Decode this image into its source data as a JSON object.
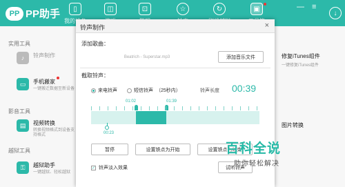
{
  "app": {
    "logo_text": "PP助手",
    "logo_badge": "P"
  },
  "nav": [
    {
      "label": "我的设备",
      "icon": "phone-icon"
    },
    {
      "label": "游戏",
      "icon": "bag-icon"
    },
    {
      "label": "影视",
      "icon": "gamepad-icon"
    },
    {
      "label": "铃声",
      "icon": "star-icon"
    },
    {
      "label": "刷机越狱",
      "icon": "refresh-icon"
    },
    {
      "label": "工具箱",
      "icon": "toolbox-icon"
    }
  ],
  "window_controls": {
    "minimize": "—",
    "menu": "≡"
  },
  "sidebar": {
    "sections": [
      "实用工具",
      "影音工具",
      "越狱工具"
    ],
    "tools": [
      {
        "name": "铃声制作",
        "desc": ""
      },
      {
        "name": "手机搬家",
        "desc": "一键搬迁数据至新设备"
      },
      {
        "name": "视频转换",
        "desc": "转换视频格式到设备支持格式"
      },
      {
        "name": "越狱助手",
        "desc": "一键越狱、轻松越狱"
      }
    ]
  },
  "right_panel": {
    "tools": [
      {
        "name": "修复iTunes组件",
        "desc": "一键修复iTunes组件"
      },
      {
        "name": "图片转换",
        "desc": ""
      }
    ]
  },
  "modal": {
    "title": "铃声制作",
    "close": "×",
    "add_song_label": "添加歌曲：",
    "file_name": "Beatrich - Superstar.mp3",
    "add_music_button": "添加音乐文件",
    "cut_label": "截取铃声：",
    "radio_call": "来电铃声",
    "radio_sms": "短信铃声",
    "sms_hint": "（25秒内）",
    "ringtone_length_label": "铃声长度",
    "ringtone_length": "00:39",
    "start_time": "01:02",
    "end_time": "01:39",
    "play_time": "00:23",
    "btn_pause": "暂停",
    "btn_set_start": "设置铁点为开始",
    "btn_set_end": "设置铁点为结束",
    "checkbox_label": "铃声淡入效果",
    "btn_preview": "试听铃声",
    "accent_color": "#2cb9a9"
  },
  "watermark": {
    "main": "百科全说",
    "sub": "助你轻松解决"
  }
}
